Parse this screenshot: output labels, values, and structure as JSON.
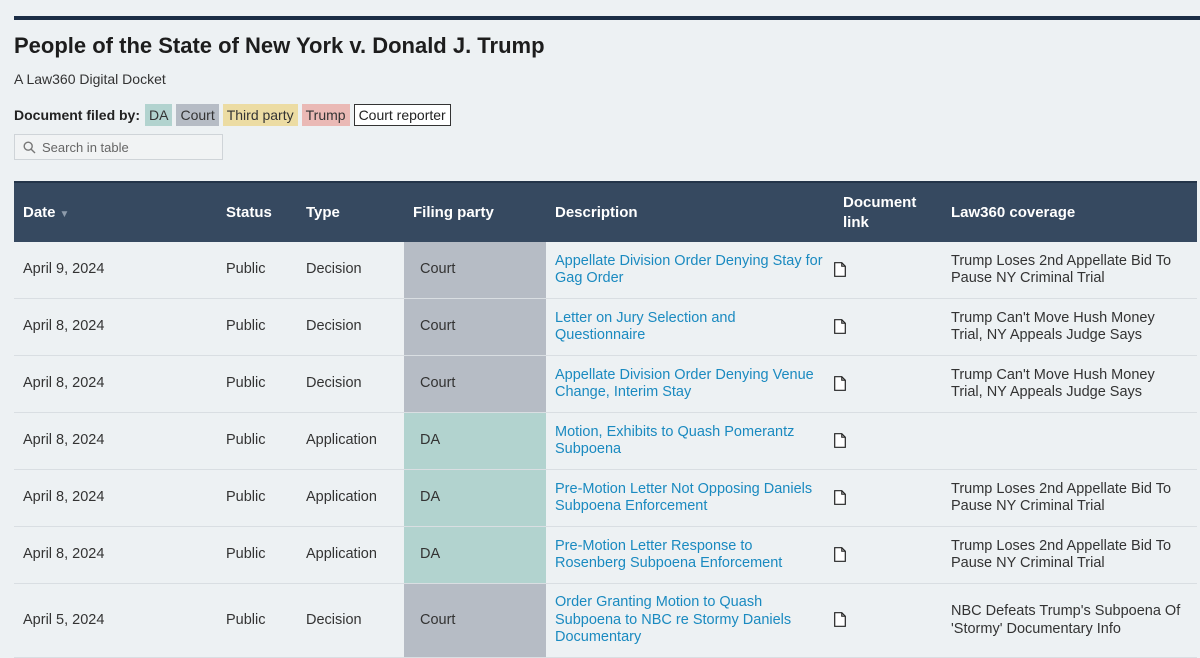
{
  "page": {
    "title": "People of the State of New York v. Donald J. Trump",
    "subtitle": "A Law360 Digital Docket"
  },
  "legend": {
    "label": "Document filed by:",
    "chips": {
      "da": "DA",
      "court": "Court",
      "third": "Third party",
      "trump": "Trump",
      "reporter": "Court reporter"
    }
  },
  "search": {
    "placeholder": "Search in table",
    "icon": "search-icon"
  },
  "columns": {
    "date": "Date",
    "date_sort_icon": "▼",
    "status": "Status",
    "type": "Type",
    "party": "Filing party",
    "description": "Description",
    "doclink_line1": "Document",
    "doclink_line2": "link",
    "coverage": "Law360 coverage"
  },
  "colors": {
    "header_bg": "#364960",
    "court": "#b6bcc5",
    "da": "#b2d3cf",
    "third_party": "#ecdca3",
    "trump": "#eab9b5",
    "link": "#1a8ac0"
  },
  "rows": [
    {
      "date": "April 9, 2024",
      "status": "Public",
      "type": "Decision",
      "party": "Court",
      "description": "Appellate Division Order Denying Stay for Gag Order",
      "doc_icon": "document-icon",
      "coverage": "Trump Loses 2nd Appellate Bid To Pause NY Criminal Trial"
    },
    {
      "date": "April 8, 2024",
      "status": "Public",
      "type": "Decision",
      "party": "Court",
      "description": "Letter on Jury Selection and Questionnaire",
      "doc_icon": "document-icon",
      "coverage": "Trump Can't Move Hush Money Trial, NY Appeals Judge Says"
    },
    {
      "date": "April 8, 2024",
      "status": "Public",
      "type": "Decision",
      "party": "Court",
      "description": "Appellate Division Order Denying Venue Change, Interim Stay",
      "doc_icon": "document-icon",
      "coverage": "Trump Can't Move Hush Money Trial, NY Appeals Judge Says"
    },
    {
      "date": "April 8, 2024",
      "status": "Public",
      "type": "Application",
      "party": "DA",
      "description": "Motion, Exhibits to Quash Pomerantz Subpoena",
      "doc_icon": "document-icon",
      "coverage": ""
    },
    {
      "date": "April 8, 2024",
      "status": "Public",
      "type": "Application",
      "party": "DA",
      "description": "Pre-Motion Letter Not Opposing Daniels Subpoena Enforcement",
      "doc_icon": "document-icon",
      "coverage": "Trump Loses 2nd Appellate Bid To Pause NY Criminal Trial"
    },
    {
      "date": "April 8, 2024",
      "status": "Public",
      "type": "Application",
      "party": "DA",
      "description": "Pre-Motion Letter Response to Rosenberg Subpoena Enforcement",
      "doc_icon": "document-icon",
      "coverage": "Trump Loses 2nd Appellate Bid To Pause NY Criminal Trial"
    },
    {
      "date": "April 5, 2024",
      "status": "Public",
      "type": "Decision",
      "party": "Court",
      "description": "Order Granting Motion to Quash Subpoena to NBC re Stormy Daniels Documentary",
      "doc_icon": "document-icon",
      "coverage": "NBC Defeats Trump's Subpoena Of 'Stormy' Documentary Info"
    }
  ]
}
